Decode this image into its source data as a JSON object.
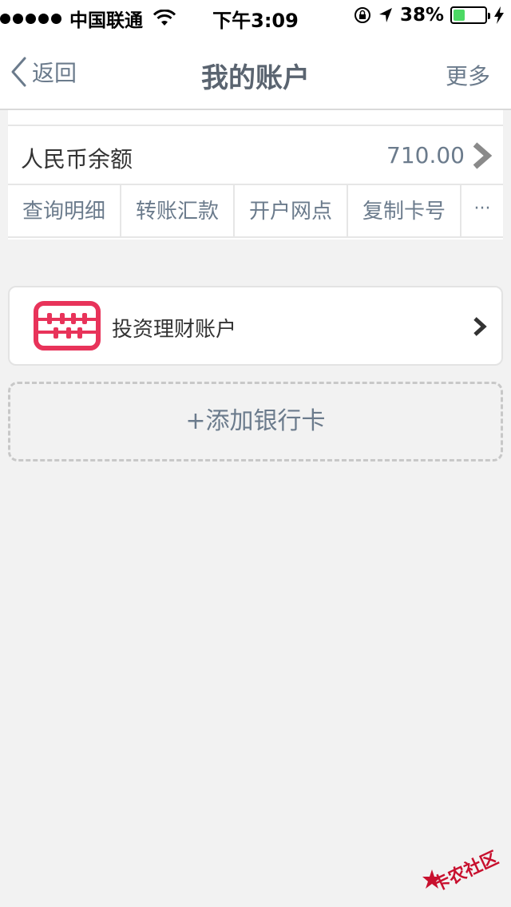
{
  "status_bar": {
    "carrier": "中国联通",
    "time": "下午3:09",
    "battery_percent": "38%",
    "battery_level": 0.38
  },
  "nav": {
    "back_label": "返回",
    "title": "我的账户",
    "more_label": "更多"
  },
  "account": {
    "balance_label": "人民币余额",
    "balance_value": "710.00",
    "actions": [
      {
        "label": "查询明细"
      },
      {
        "label": "转账汇款"
      },
      {
        "label": "开户网点"
      },
      {
        "label": "复制卡号"
      },
      {
        "label": "···"
      }
    ]
  },
  "investment": {
    "label": "投资理财账户",
    "icon": "abacus-icon",
    "icon_color": "#e8335a"
  },
  "add_card": {
    "label": "+添加银行卡"
  },
  "watermark": {
    "text": "卡农社区",
    "color": "#c8102e"
  }
}
